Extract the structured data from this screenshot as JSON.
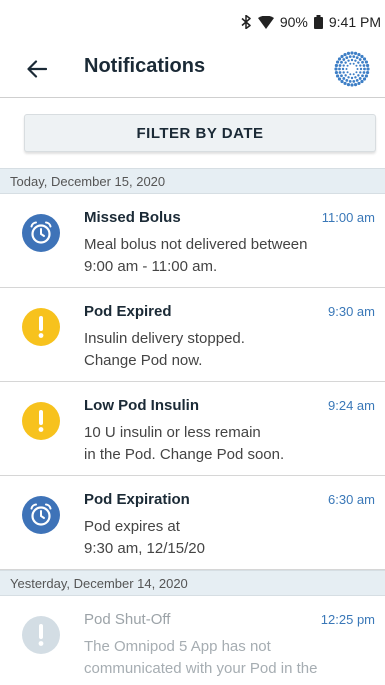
{
  "status_bar": {
    "battery": "90%",
    "time": "9:41 PM"
  },
  "header": {
    "title": "Notifications",
    "back_icon": "arrow-left-icon",
    "logo_icon": "omnipod-logo-icon"
  },
  "filter": {
    "label": "FILTER BY DATE"
  },
  "colors": {
    "accent_blue": "#3e73b8",
    "alert_yellow": "#f7c21d",
    "time_blue": "#3a78b8",
    "date_header_bg": "#e6eef3"
  },
  "groups": [
    {
      "date": "Today, December 15, 2020",
      "items": [
        {
          "icon": "alarm-clock-icon",
          "title": "Missed Bolus",
          "time": "11:00 am",
          "line1": "Meal bolus not delivered between",
          "line2": "9:00 am - 11:00 am."
        },
        {
          "icon": "exclamation-icon",
          "title": "Pod Expired",
          "time": "9:30 am",
          "line1": "Insulin delivery stopped.",
          "line2": "Change Pod now."
        },
        {
          "icon": "exclamation-icon",
          "title": "Low Pod Insulin",
          "time": "9:24 am",
          "line1": "10 U insulin or less remain",
          "line2": "in the Pod. Change Pod soon."
        },
        {
          "icon": "alarm-clock-icon",
          "title": "Pod Expiration",
          "time": "6:30 am",
          "line1": "Pod expires at",
          "line2": "9:30 am, 12/15/20"
        }
      ]
    },
    {
      "date": "Yesterday, December 14, 2020",
      "items": [
        {
          "icon": "exclamation-icon",
          "title": "Pod Shut-Off",
          "time": "12:25 pm",
          "line1": "The Omnipod 5 App has not",
          "line2": "communicated with your Pod in the"
        }
      ]
    }
  ]
}
